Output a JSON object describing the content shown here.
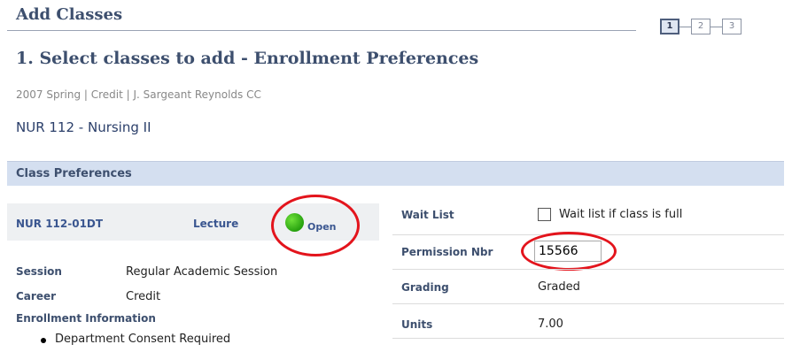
{
  "header": {
    "title": "Add Classes",
    "steps": [
      "1",
      "2",
      "3"
    ],
    "active_step": "1"
  },
  "section_title": "1. Select classes to add - Enrollment Preferences",
  "term_line": "2007 Spring | Credit | J. Sargeant Reynolds CC",
  "course_title": "NUR  112 - Nursing II",
  "class_preferences": {
    "header": "Class Preferences",
    "class_id": "NUR 112-01DT",
    "component": "Lecture",
    "status": "Open",
    "status_color": "#2fae14",
    "session_label": "Session",
    "session_value": "Regular Academic Session",
    "career_label": "Career",
    "career_value": "Credit",
    "enrollment_info_label": "Enrollment Information",
    "enrollment_info_items": [
      "Department Consent Required"
    ]
  },
  "options": {
    "wait_list_label": "Wait List",
    "wait_list_checkbox_label": "Wait list if class is full",
    "wait_list_checked": false,
    "permission_label": "Permission Nbr",
    "permission_value": "15566",
    "grading_label": "Grading",
    "grading_value": "Graded",
    "units_label": "Units",
    "units_value": "7.00"
  },
  "colors": {
    "title": "#3d4f6e",
    "section_header_bg": "#d4dff0",
    "link_blue": "#3a5690",
    "highlight_circle": "#e3141c"
  }
}
